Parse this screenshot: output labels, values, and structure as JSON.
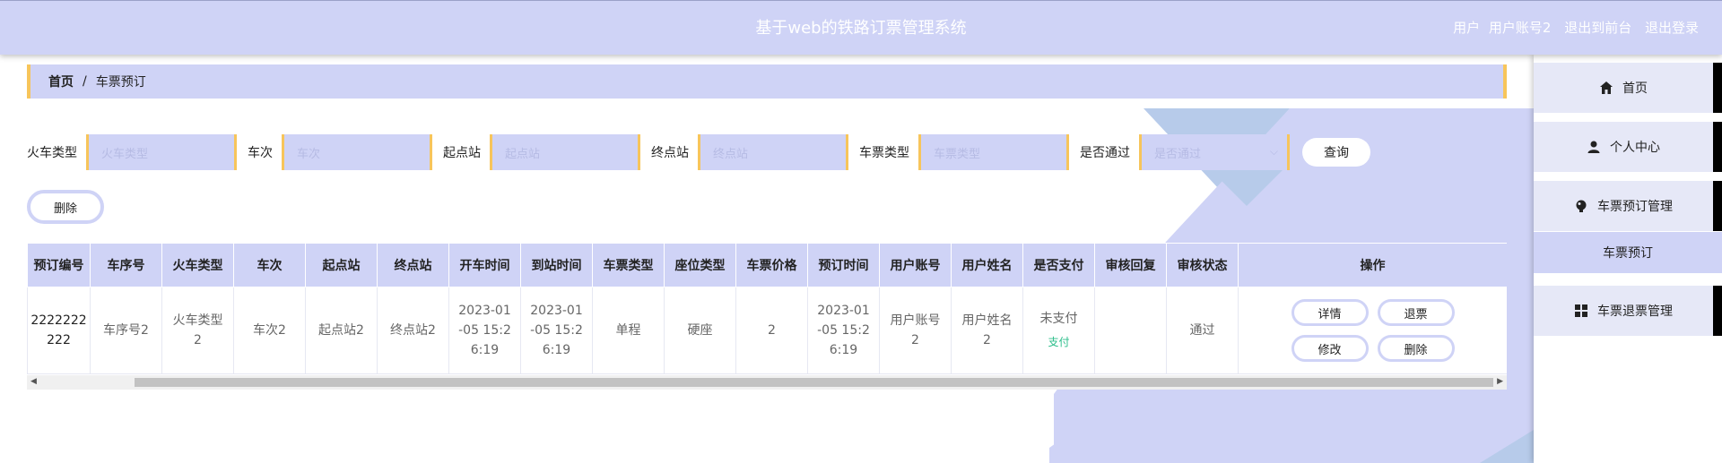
{
  "header": {
    "title": "基于web的铁路订票管理系统",
    "user_label": "用户",
    "user_name": "用户账号2",
    "back_link": "退出到前台",
    "logout_link": "退出登录"
  },
  "breadcrumb": {
    "home": "首页",
    "separator": "/",
    "current": "车票预订"
  },
  "search": {
    "fields": [
      {
        "label": "火车类型",
        "placeholder": "火车类型"
      },
      {
        "label": "车次",
        "placeholder": "车次"
      },
      {
        "label": "起点站",
        "placeholder": "起点站"
      },
      {
        "label": "终点站",
        "placeholder": "终点站"
      },
      {
        "label": "车票类型",
        "placeholder": "车票类型"
      },
      {
        "label": "是否通过",
        "placeholder": "是否通过"
      }
    ],
    "query_button": "查询"
  },
  "toolbar": {
    "delete_button": "删除"
  },
  "table": {
    "columns": [
      "预订编号",
      "车序号",
      "火车类型",
      "车次",
      "起点站",
      "终点站",
      "开车时间",
      "到站时间",
      "车票类型",
      "座位类型",
      "车票价格",
      "预订时间",
      "用户账号",
      "用户姓名",
      "是否支付",
      "审核回复",
      "审核状态",
      "操作"
    ],
    "rows": [
      {
        "order_no": "2222222\n222",
        "car_no": "车序号2",
        "train_type": "火车类型\n2",
        "train_no": "车次2",
        "start": "起点站2",
        "end": "终点站2",
        "depart": "2023-01\n-05 15:2\n6:19",
        "arrive": "2023-01\n-05 15:2\n6:19",
        "ticket_type": "单程",
        "seat_type": "硬座",
        "price": "2",
        "book_time": "2023-01\n-05 15:2\n6:19",
        "account": "用户账号\n2",
        "name": "用户姓名\n2",
        "paid": "未支付",
        "pay_link": "支付",
        "reply": "",
        "status": "通过",
        "actions": [
          "详情",
          "退票",
          "修改",
          "删除"
        ]
      }
    ]
  },
  "sidebar": {
    "items": [
      {
        "label": "首页",
        "icon": "home-icon"
      },
      {
        "label": "个人中心",
        "icon": "user-icon"
      },
      {
        "label": "车票预订管理",
        "icon": "ticket-manage-icon"
      },
      {
        "label": "车票退票管理",
        "icon": "grid-icon"
      }
    ],
    "submenu": "车票预订"
  },
  "colors": {
    "accent": "#cfd3f6",
    "highlight": "#f7c55b",
    "link_green": "#2bbd8a"
  }
}
